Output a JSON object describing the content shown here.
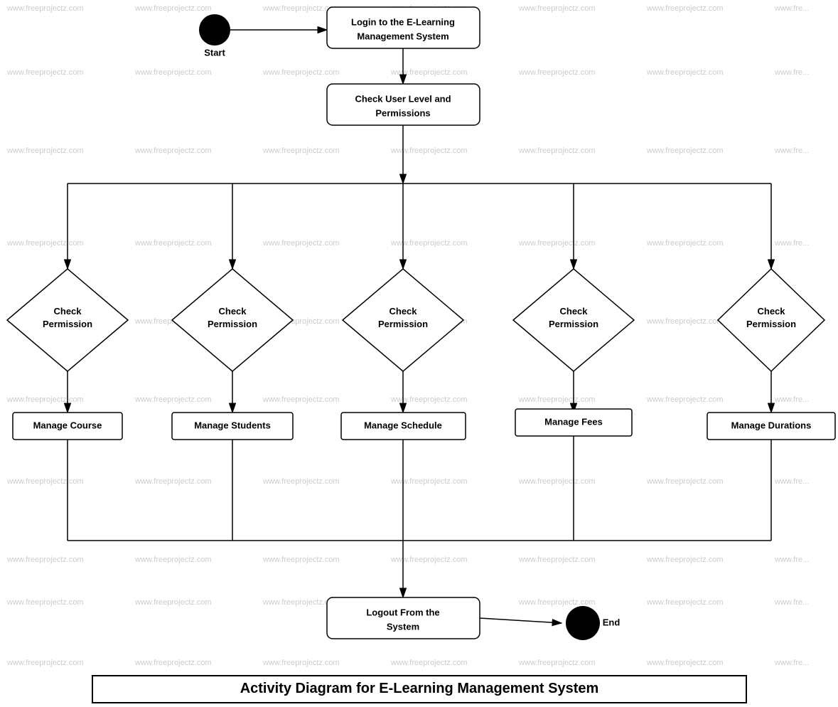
{
  "diagram": {
    "title": "Activity Diagram for E-Learning Management System",
    "nodes": {
      "start_label": "Start",
      "end_label": "End",
      "login": "Login to the E-Learning\nManagement System",
      "check_user": "Check User Level and\nPermissions",
      "logout": "Logout From the\nSystem",
      "check_permission_1": "Check\nPermission",
      "check_permission_2": "Check\nPermission",
      "check_permission_3": "Check\nPermission",
      "check_permission_4": "Check\nPermission",
      "check_permission_5": "Check\nPermission",
      "manage_course": "Manage Course",
      "manage_students": "Manage Students",
      "manage_schedule": "Manage Schedule",
      "manage_fees": "Manage Fees",
      "manage_durations": "Manage Durations"
    },
    "watermark": "www.freeprojectz.com"
  }
}
